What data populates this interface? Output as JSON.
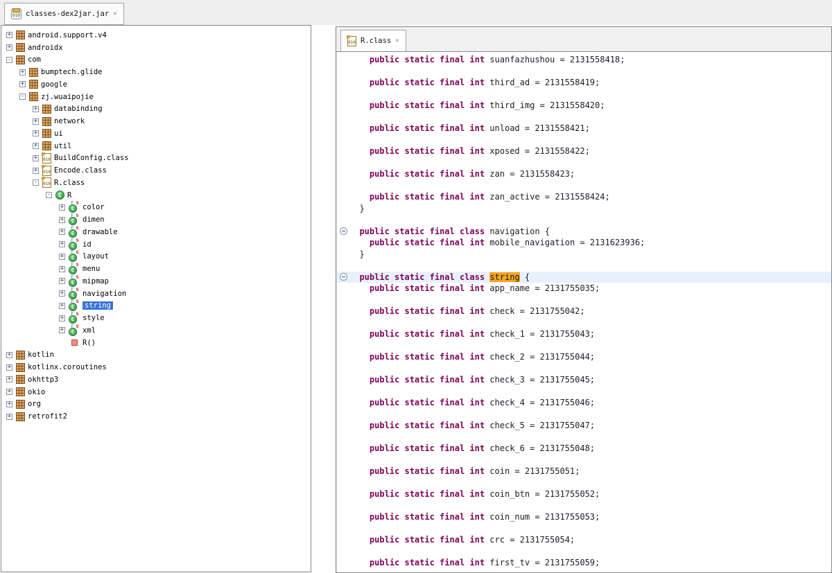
{
  "main_tab": {
    "label": "classes-dex2jar.jar",
    "close": "✕"
  },
  "icons": {
    "binary_text": "010",
    "class_letter": "C",
    "inner_badge_f": "F",
    "inner_badge_s": "s"
  },
  "colors": {
    "keyword": "#7f0055",
    "plain_code": "#1b1b26",
    "occurrence_highlight_bg": "#f5a41f",
    "current_line_bg": "#e7f1fc",
    "tree_selection_bg": "#3674d9",
    "package_icon_brown": "#d9a55e",
    "class_icon_green": "#2f9240",
    "class_file_gold": "#9a7b2d",
    "tab_bar_bg": "#f0f0f0"
  },
  "tree": {
    "items": [
      {
        "label": "android.support.v4",
        "level": 0,
        "expander": "plus",
        "icon": "package"
      },
      {
        "label": "androidx",
        "level": 0,
        "expander": "plus",
        "icon": "package"
      },
      {
        "label": "com",
        "level": 0,
        "expander": "minus",
        "icon": "package"
      },
      {
        "label": "bumptech.glide",
        "level": 1,
        "expander": "plus",
        "icon": "package"
      },
      {
        "label": "google",
        "level": 1,
        "expander": "plus",
        "icon": "package"
      },
      {
        "label": "zj.wuaipojie",
        "level": 1,
        "expander": "minus",
        "icon": "package"
      },
      {
        "label": "databinding",
        "level": 2,
        "expander": "plus",
        "icon": "package"
      },
      {
        "label": "network",
        "level": 2,
        "expander": "plus",
        "icon": "package"
      },
      {
        "label": "ui",
        "level": 2,
        "expander": "plus",
        "icon": "package"
      },
      {
        "label": "util",
        "level": 2,
        "expander": "plus",
        "icon": "package"
      },
      {
        "label": "BuildConfig.class",
        "level": 2,
        "expander": "plus",
        "icon": "classfile"
      },
      {
        "label": "Encode.class",
        "level": 2,
        "expander": "plus",
        "icon": "classfile"
      },
      {
        "label": "R.class",
        "level": 2,
        "expander": "minus",
        "icon": "classfile"
      },
      {
        "label": "R",
        "level": 3,
        "expander": "minus",
        "icon": "class"
      },
      {
        "label": "color",
        "level": 4,
        "expander": "plus",
        "icon": "innerclass"
      },
      {
        "label": "dimen",
        "level": 4,
        "expander": "plus",
        "icon": "innerclass"
      },
      {
        "label": "drawable",
        "level": 4,
        "expander": "plus",
        "icon": "innerclass"
      },
      {
        "label": "id",
        "level": 4,
        "expander": "plus",
        "icon": "innerclass"
      },
      {
        "label": "layout",
        "level": 4,
        "expander": "plus",
        "icon": "innerclass"
      },
      {
        "label": "menu",
        "level": 4,
        "expander": "plus",
        "icon": "innerclass"
      },
      {
        "label": "mipmap",
        "level": 4,
        "expander": "plus",
        "icon": "innerclass"
      },
      {
        "label": "navigation",
        "level": 4,
        "expander": "plus",
        "icon": "innerclass"
      },
      {
        "label": "string",
        "level": 4,
        "expander": "plus",
        "icon": "innerclass",
        "selected": true
      },
      {
        "label": "style",
        "level": 4,
        "expander": "plus",
        "icon": "innerclass"
      },
      {
        "label": "xml",
        "level": 4,
        "expander": "plus",
        "icon": "innerclass"
      },
      {
        "label": "R()",
        "level": 4,
        "expander": "none",
        "icon": "method"
      },
      {
        "label": "kotlin",
        "level": 0,
        "expander": "plus",
        "icon": "package"
      },
      {
        "label": "kotlinx.coroutines",
        "level": 0,
        "expander": "plus",
        "icon": "package"
      },
      {
        "label": "okhttp3",
        "level": 0,
        "expander": "plus",
        "icon": "package"
      },
      {
        "label": "okio",
        "level": 0,
        "expander": "plus",
        "icon": "package"
      },
      {
        "label": "org",
        "level": 0,
        "expander": "plus",
        "icon": "package"
      },
      {
        "label": "retrofit2",
        "level": 0,
        "expander": "plus",
        "icon": "package"
      }
    ]
  },
  "editor": {
    "tab": {
      "label": "R.class",
      "close": "✕"
    },
    "lines": [
      {
        "t": "f",
        "ind": 4,
        "kw": "public static final int",
        "name": "suanfazhushou",
        "value": "2131558418"
      },
      {
        "t": "blank"
      },
      {
        "t": "f",
        "ind": 4,
        "kw": "public static final int",
        "name": "third_ad",
        "value": "2131558419"
      },
      {
        "t": "blank"
      },
      {
        "t": "f",
        "ind": 4,
        "kw": "public static final int",
        "name": "third_img",
        "value": "2131558420"
      },
      {
        "t": "blank"
      },
      {
        "t": "f",
        "ind": 4,
        "kw": "public static final int",
        "name": "unload",
        "value": "2131558421"
      },
      {
        "t": "blank"
      },
      {
        "t": "f",
        "ind": 4,
        "kw": "public static final int",
        "name": "xposed",
        "value": "2131558422"
      },
      {
        "t": "blank"
      },
      {
        "t": "f",
        "ind": 4,
        "kw": "public static final int",
        "name": "zan",
        "value": "2131558423"
      },
      {
        "t": "blank"
      },
      {
        "t": "f",
        "ind": 4,
        "kw": "public static final int",
        "name": "zan_active",
        "value": "2131558424"
      },
      {
        "t": "x",
        "ind": 2,
        "text": "}"
      },
      {
        "t": "blank"
      },
      {
        "t": "k",
        "ind": 2,
        "kw": "public static final class",
        "name": "navigation",
        "fold": true
      },
      {
        "t": "f",
        "ind": 4,
        "kw": "public static final int",
        "name": "mobile_navigation",
        "value": "2131623936"
      },
      {
        "t": "x",
        "ind": 2,
        "text": "}"
      },
      {
        "t": "blank"
      },
      {
        "t": "k",
        "ind": 2,
        "kw": "public static final class",
        "name": "string",
        "fold": true,
        "hl": true,
        "cur": true
      },
      {
        "t": "f",
        "ind": 4,
        "kw": "public static final int",
        "name": "app_name",
        "value": "2131755035"
      },
      {
        "t": "blank"
      },
      {
        "t": "f",
        "ind": 4,
        "kw": "public static final int",
        "name": "check",
        "value": "2131755042"
      },
      {
        "t": "blank"
      },
      {
        "t": "f",
        "ind": 4,
        "kw": "public static final int",
        "name": "check_1",
        "value": "2131755043"
      },
      {
        "t": "blank"
      },
      {
        "t": "f",
        "ind": 4,
        "kw": "public static final int",
        "name": "check_2",
        "value": "2131755044"
      },
      {
        "t": "blank"
      },
      {
        "t": "f",
        "ind": 4,
        "kw": "public static final int",
        "name": "check_3",
        "value": "2131755045"
      },
      {
        "t": "blank"
      },
      {
        "t": "f",
        "ind": 4,
        "kw": "public static final int",
        "name": "check_4",
        "value": "2131755046"
      },
      {
        "t": "blank"
      },
      {
        "t": "f",
        "ind": 4,
        "kw": "public static final int",
        "name": "check_5",
        "value": "2131755047"
      },
      {
        "t": "blank"
      },
      {
        "t": "f",
        "ind": 4,
        "kw": "public static final int",
        "name": "check_6",
        "value": "2131755048"
      },
      {
        "t": "blank"
      },
      {
        "t": "f",
        "ind": 4,
        "kw": "public static final int",
        "name": "coin",
        "value": "2131755051"
      },
      {
        "t": "blank"
      },
      {
        "t": "f",
        "ind": 4,
        "kw": "public static final int",
        "name": "coin_btn",
        "value": "2131755052"
      },
      {
        "t": "blank"
      },
      {
        "t": "f",
        "ind": 4,
        "kw": "public static final int",
        "name": "coin_num",
        "value": "2131755053"
      },
      {
        "t": "blank"
      },
      {
        "t": "f",
        "ind": 4,
        "kw": "public static final int",
        "name": "crc",
        "value": "2131755054"
      },
      {
        "t": "blank"
      },
      {
        "t": "f",
        "ind": 4,
        "kw": "public static final int",
        "name": "first_tv",
        "value": "2131755059"
      }
    ]
  }
}
